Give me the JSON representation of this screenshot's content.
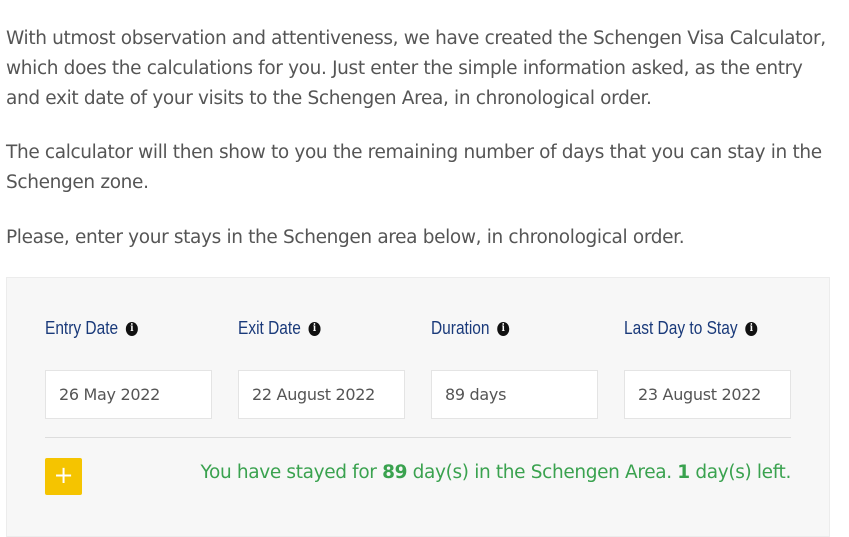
{
  "intro": {
    "p1": "With utmost observation and attentiveness, we have created the Schengen Visa Calculator, which does the calculations for you. Just enter the simple information asked, as the entry and exit date of your visits to the Schengen Area, in chronological order.",
    "p2": "The calculator will then show to you the remaining number of days that you can stay in the Schengen zone.",
    "p3": "Please, enter your stays in the Schengen area below, in chronological order."
  },
  "calculator": {
    "headers": {
      "entry": "Entry Date",
      "exit": "Exit Date",
      "duration": "Duration",
      "last_day": "Last Day to Stay"
    },
    "info_icon": "i",
    "row": {
      "entry_date": "26 May 2022",
      "exit_date": "22 August 2022",
      "duration": "89 days",
      "last_day": "23 August 2022"
    },
    "add_button_label": "+",
    "result": {
      "prefix": "You have stayed for ",
      "days_stayed": "89",
      "middle": " day(s) in the Schengen Area. ",
      "days_left": "1",
      "suffix": " day(s) left."
    }
  },
  "colors": {
    "header_text": "#1a3a7a",
    "add_button": "#f5c400",
    "result_text": "#3aa24f",
    "panel_bg": "#f7f7f7"
  },
  "icons": {
    "info": "info-icon",
    "add": "plus-icon"
  }
}
